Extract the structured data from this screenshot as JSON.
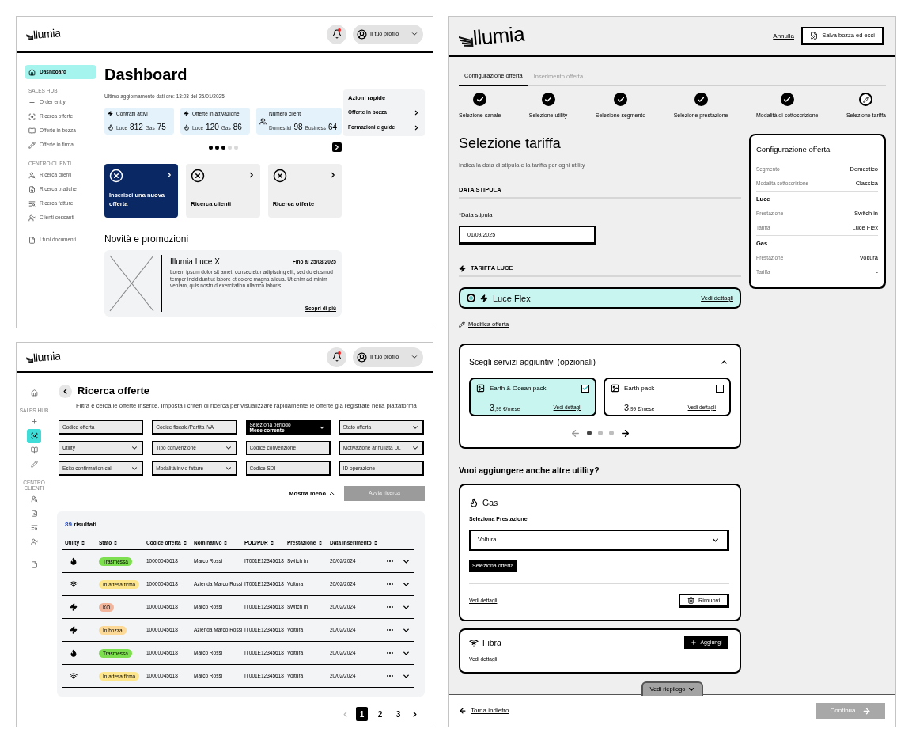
{
  "dashboard": {
    "header": {
      "logo": "llumia",
      "notification": true,
      "profile": "Il tuo profilo"
    },
    "sidebar": {
      "sections": [
        {
          "items": [
            {
              "label": "Dashboard",
              "selected": true
            }
          ]
        },
        {
          "label": "SALES HUB",
          "items": [
            {
              "label": "Order entry",
              "selected": false
            },
            {
              "label": "Ricerca offerte",
              "selected": false
            },
            {
              "label": "Offerte in bozza",
              "selected": false
            },
            {
              "label": "Offerte in firma",
              "selected": false
            }
          ]
        },
        {
          "label": "CENTRO CLIENTI",
          "items": [
            {
              "label": "Ricerca clienti",
              "selected": false
            },
            {
              "label": "Ricerca pratiche",
              "selected": false
            },
            {
              "label": "Ricerca fatture",
              "selected": false
            },
            {
              "label": "Clienti cessanti",
              "selected": false
            }
          ]
        },
        {
          "items": [
            {
              "label": "I tuoi documenti",
              "selected": false
            }
          ]
        }
      ]
    },
    "title": "Dashboard",
    "last_update": "Ultimo aggiornamento dati ore: 13:03 del 25/01/2025",
    "stats": [
      {
        "kind": "utility",
        "title": "Contratti attivi",
        "values": [
          {
            "label": "Luce",
            "value": "812"
          },
          {
            "label": "Gas",
            "value": "75"
          }
        ]
      },
      {
        "kind": "utility",
        "title": "Offerte in attivazione",
        "values": [
          {
            "label": "Luce",
            "value": "120"
          },
          {
            "label": "Gas",
            "value": "86"
          }
        ]
      },
      {
        "kind": "clients",
        "title": "Numero clienti",
        "values": [
          {
            "label": "Domestici",
            "value": "98"
          },
          {
            "label": "Business",
            "value": "64"
          }
        ]
      }
    ],
    "carousel_dots": [
      {
        "active": true
      },
      {
        "active": true
      },
      {
        "active": true
      },
      {
        "active": false
      },
      {
        "active": false
      }
    ],
    "quick_actions": {
      "title": "Azioni rapide",
      "items": [
        "Offerte in bozza",
        "Formazioni e guide"
      ]
    },
    "tiles": [
      {
        "label": "Inserisci una nuova offerta",
        "highlighted": true
      },
      {
        "label": "Ricerca clienti",
        "highlighted": false
      },
      {
        "label": "Ricerca offerte",
        "highlighted": false
      }
    ],
    "news": {
      "heading": "Novità e promozioni",
      "cards": [
        {
          "title": "Illumia Luce X",
          "until": "Fino al 25/08/2025",
          "text": "Lorem ipsum dolor sit amet, consectetur adipiscing elit, sed do eiusmod tempor incididunt ut labore et dolore magna aliqua. Ut enim ad minim veniam, quis nostrud exercitation ullamco laboris",
          "link": "Scopri di più"
        }
      ]
    }
  },
  "offer_search": {
    "header": {
      "logo": "llumia",
      "notification": true,
      "profile": "Il tuo profilo"
    },
    "sidebar": {
      "sections": [
        {
          "items": [
            {
              "selected": false
            }
          ]
        },
        {
          "label": "SALES HUB",
          "items": [
            {
              "selected": false
            },
            {
              "selected": true
            },
            {
              "selected": false
            },
            {
              "selected": false
            }
          ]
        },
        {
          "label": "CENTRO CLIENTI",
          "items": [
            {
              "selected": false
            },
            {
              "selected": false
            },
            {
              "selected": false
            },
            {
              "selected": false
            }
          ]
        },
        {
          "items": [
            {
              "selected": false
            }
          ]
        }
      ]
    },
    "title": "Ricerca offerte",
    "subtitle": "Filtra e cerca le offerte inserite. Imposta i criteri di ricerca per visualizzare rapidamente le offerte già registrate nella piattaforma",
    "filters": [
      {
        "kind": "input",
        "placeholder": "Codice offerta",
        "active": false
      },
      {
        "kind": "input",
        "placeholder": "Codice fiscale/Partita IVA",
        "active": false
      },
      {
        "kind": "select",
        "label": "Seleziona periodo",
        "value": "Mese corrente",
        "active": true
      },
      {
        "kind": "select",
        "placeholder": "Stato offerta",
        "active": false
      },
      {
        "kind": "select",
        "placeholder": "Utility",
        "active": false
      },
      {
        "kind": "select",
        "placeholder": "Tipo convenzione",
        "active": false
      },
      {
        "kind": "input",
        "placeholder": "Codice convenzione",
        "active": false
      },
      {
        "kind": "select",
        "placeholder": "Motivazione annullata DL",
        "active": false
      },
      {
        "kind": "select",
        "placeholder": "Esito confirmation call",
        "active": false
      },
      {
        "kind": "select",
        "placeholder": "Modalità invio fatture",
        "active": false
      },
      {
        "kind": "input",
        "placeholder": "Codice SDI",
        "active": false
      },
      {
        "kind": "input",
        "placeholder": "ID operazione",
        "active": false
      }
    ],
    "toggle": "Mostra meno",
    "search_button": {
      "label": "Avvia ricerca",
      "disabled": true
    },
    "results": {
      "count": "89",
      "label": "risultati"
    },
    "table": {
      "columns": [
        "Utility",
        "Stato",
        "Codice offerta",
        "Nominativo",
        "POD/PDR",
        "Prestazione",
        "Data inserimento"
      ],
      "rows": [
        {
          "kind": "gas",
          "status": {
            "label": "Trasmessa",
            "color": "#7ddf4f"
          },
          "code": "10000045618",
          "name": "Marco Rossi",
          "pod": "IT001E12345618",
          "service": "Switch in",
          "date": "20/02/2024"
        },
        {
          "kind": "fibra",
          "status": {
            "label": "In attesa firma",
            "color": "#fce58a"
          },
          "code": "10000045618",
          "name": "Azienda Marco Rossi",
          "pod": "IT001E12345618",
          "service": "Voltura",
          "date": "20/02/2024"
        },
        {
          "kind": "luce",
          "status": {
            "label": "KO",
            "color": "#f3b49c"
          },
          "code": "10000045618",
          "name": "Marco Rossi",
          "pod": "IT001E12345618",
          "service": "Switch in",
          "date": "20/02/2024"
        },
        {
          "kind": "luce",
          "status": {
            "label": "In bozza",
            "color": "#fcd996"
          },
          "code": "10000045618",
          "name": "Azienda Marco Rossi",
          "pod": "IT001E12345618",
          "service": "Voltura",
          "date": "20/02/2024"
        },
        {
          "kind": "gas",
          "status": {
            "label": "Trasmessa",
            "color": "#7ddf4f"
          },
          "code": "10000045618",
          "name": "Marco Rossi",
          "pod": "IT001E12345618",
          "service": "Voltura",
          "date": "20/02/2024"
        },
        {
          "kind": "fibra",
          "status": {
            "label": "In attesa firma",
            "color": "#fce58a"
          },
          "code": "10000045618",
          "name": "Marco Rossi",
          "pod": "IT001E12345618",
          "service": "Voltura",
          "date": "20/02/2024"
        }
      ]
    },
    "pagination": {
      "prev_disabled": true,
      "pages": [
        {
          "label": "1",
          "selected": true
        },
        {
          "label": "2",
          "selected": false
        },
        {
          "label": "3",
          "selected": false
        }
      ]
    }
  },
  "offer_config": {
    "header": {
      "logo": "llumia",
      "cancel": "Annulla",
      "save": "Salva bozza ed esci"
    },
    "tabs": [
      {
        "label": "Configurazione offerta",
        "selected": true
      },
      {
        "label": "Inserimento offerta",
        "selected": false
      }
    ],
    "steps": [
      {
        "label": "Selezione canale",
        "completed": true
      },
      {
        "label": "Selezione utility",
        "completed": true
      },
      {
        "label": "Selezione segmento",
        "completed": true
      },
      {
        "label": "Selezione prestazione",
        "completed": true
      },
      {
        "label": "Modalità di sottoscrizione",
        "completed": true
      },
      {
        "label": "Selezione tariffa",
        "completed": false
      }
    ],
    "title": "Selezione tariffa",
    "subtitle": "Indica la data di stipula e la tariffa per ogni utility",
    "date_section": {
      "heading": "DATA STIPULA",
      "label": "*Data stipula",
      "value": "01/09/2025"
    },
    "tariff_section": {
      "heading": "TARIFFA LUCE",
      "options": [
        {
          "name": "Luce Flex",
          "selected": true,
          "link": "Vedi dettagli"
        }
      ],
      "edit_link": "Modifica offerta"
    },
    "services": {
      "title": "Scegli servizi aggiuntivi (opzionali)",
      "expanded": true,
      "items": [
        {
          "name": "Earth & Ocean pack",
          "price_main": "3",
          "price_rest": ",99 €/mese",
          "link": "Vedi dettagli",
          "checked": true
        },
        {
          "name": "Earth pack",
          "price_main": "3",
          "price_rest": ",99 €/mese",
          "link": "Vedi dettagli",
          "checked": false
        }
      ],
      "prev_disabled": true,
      "dots": [
        {
          "selected": true
        },
        {
          "selected": false
        },
        {
          "selected": false
        }
      ]
    },
    "utilities": {
      "heading": "Vuoi aggiungere anche altre utility?",
      "items": [
        {
          "kind": "gas",
          "name": "Gas",
          "added": true,
          "select_label": "Seleziona Prestazione",
          "select_value": "Voltura",
          "select_offer": "Seleziona offerta",
          "link": "Vedi dettagli",
          "remove": "Rimuovi"
        },
        {
          "kind": "fibra",
          "name": "Fibra",
          "added": false,
          "add": "Aggiungi",
          "link": "Vedi dettagli"
        }
      ]
    },
    "summary": {
      "title": "Configurazione offerta",
      "groups": [
        {
          "rows": [
            {
              "label": "Segmento",
              "value": "Domestico"
            },
            {
              "label": "Modalità sottoscrizione",
              "value": "Classica"
            }
          ]
        },
        {
          "heading": "Luce",
          "rows": [
            {
              "label": "Prestazione",
              "value": "Switch in"
            },
            {
              "label": "Tariffa",
              "value": "Luce Flex"
            }
          ]
        },
        {
          "heading": "Gas",
          "rows": [
            {
              "label": "Prestazione",
              "value": "Voltura"
            },
            {
              "label": "Tariffa",
              "value": "-"
            }
          ]
        }
      ]
    },
    "summary_toggle": "Vedi riepilogo",
    "footer": {
      "back": "Torna indietro",
      "continue": {
        "label": "Continua",
        "disabled": true
      }
    }
  }
}
